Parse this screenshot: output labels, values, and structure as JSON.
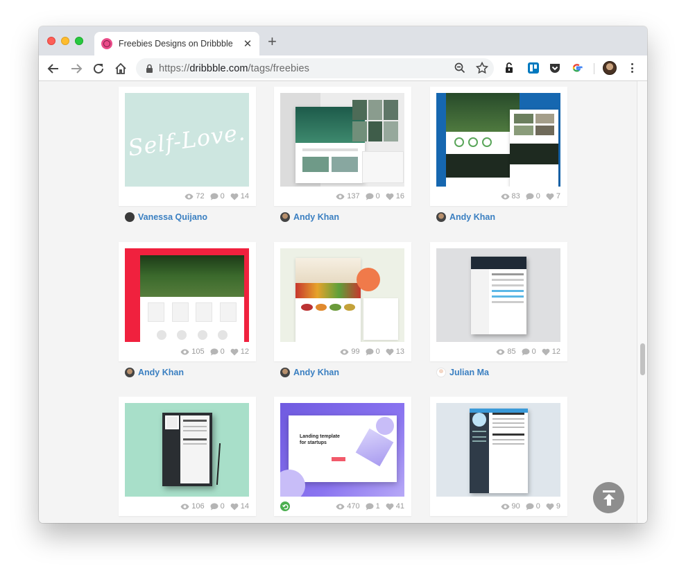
{
  "browser": {
    "tab_title": "Freebies Designs on Dribbble",
    "new_tab_symbol": "+",
    "close_symbol": "✕",
    "url_scheme": "https://",
    "url_host": "dribbble.com",
    "url_path": "/tags/freebies"
  },
  "shots": [
    {
      "views": "72",
      "comments": "0",
      "likes": "14",
      "author": "Vanessa Quijano",
      "thumb_text": "Self-Love."
    },
    {
      "views": "137",
      "comments": "0",
      "likes": "16",
      "author": "Andy Khan"
    },
    {
      "views": "83",
      "comments": "0",
      "likes": "7",
      "author": "Andy Khan"
    },
    {
      "views": "105",
      "comments": "0",
      "likes": "12",
      "author": "Andy Khan"
    },
    {
      "views": "99",
      "comments": "0",
      "likes": "13",
      "author": "Andy Khan"
    },
    {
      "views": "85",
      "comments": "0",
      "likes": "12",
      "author": "Julian Ma"
    },
    {
      "views": "106",
      "comments": "0",
      "likes": "14"
    },
    {
      "views": "470",
      "comments": "1",
      "likes": "41",
      "thumb_text": "Landing template for startups"
    },
    {
      "views": "90",
      "comments": "0",
      "likes": "9"
    }
  ],
  "colors": {
    "accent_link": "#3a7fc1",
    "dribbble_pink": "#ea4c89"
  }
}
